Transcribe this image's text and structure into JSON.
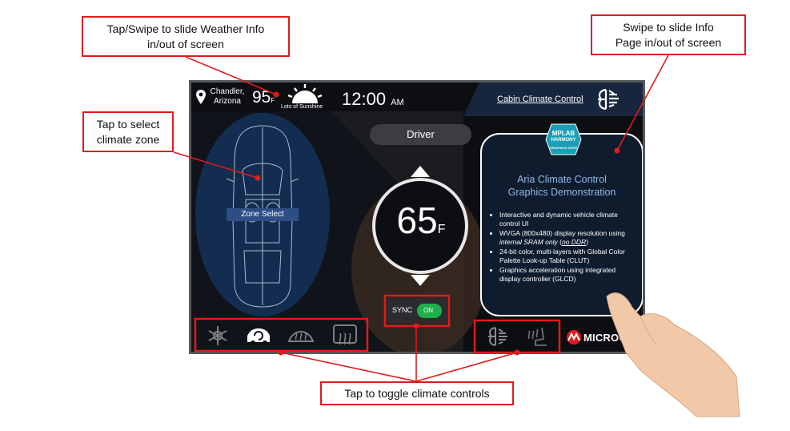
{
  "callouts": {
    "weather": "Tap/Swipe to slide Weather Info in/out of screen",
    "info_page": "Swipe to slide Info Page in/out of screen",
    "zone": "Tap to select climate zone",
    "toggle": "Tap to toggle climate controls"
  },
  "topbar": {
    "location_line1": "Chandler,",
    "location_line2": "Arizona",
    "temperature": "95",
    "temperature_unit": "F",
    "weather_desc": "Lots of Sunshine",
    "time": "12:00",
    "ampm": "AM",
    "cabin_title": "Cabin Climate Control"
  },
  "zone": {
    "label": "Zone Select"
  },
  "driver": {
    "label": "Driver",
    "temperature": "65",
    "unit": "F"
  },
  "sync": {
    "label": "SYNC",
    "state": "ON"
  },
  "info": {
    "logo_line1": "MPLAB",
    "logo_line2": "HARMONY",
    "logo_line3": "GRAPHICS SUITE",
    "title_line1": "Aria Climate Control",
    "title_line2": "Graphics Demonstration",
    "bullets": {
      "b1": "Interactive and dynamic vehicle climate control UI",
      "b2_pre": "WVGA (800x480) display resolution using ",
      "b2_em": "internal SRAM only",
      "b2_mid": " (",
      "b2_u": "no DDR",
      "b2_post": ")",
      "b3": "24-bit color, multi-layers with Global Color Palette Look-up Table (CLUT)",
      "b4": "Graphics acceleration using integrated display controller (GLCD)"
    }
  },
  "brand": {
    "name": "MICROCHIP"
  },
  "colors": {
    "accent_red": "#e01b1b",
    "sync_green": "#1fb04a",
    "panel_border": "#ffffff",
    "panel_bg": "#0f1c2e"
  }
}
